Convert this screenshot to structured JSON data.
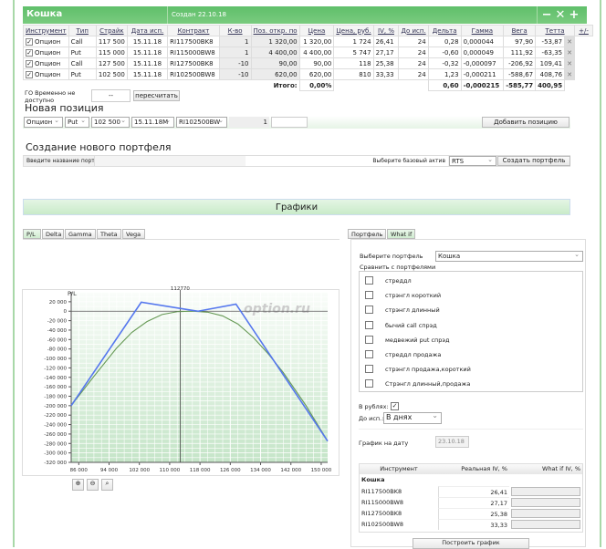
{
  "portfolio": {
    "name": "Кошка",
    "created": "Создан 22.10.18",
    "controls": [
      "−",
      "✕",
      "+"
    ]
  },
  "table": {
    "headers": [
      "Инструмент",
      "Тип",
      "Страйк",
      "Дата исп.",
      "Контракт",
      "К-во",
      "Поз. откр. по",
      "Цена",
      "Цена, руб.",
      "IV, %",
      "До исп.",
      "Дельта",
      "Гамма",
      "Вега",
      "Тетта",
      "+/-"
    ],
    "rows": [
      {
        "checked": true,
        "instrument": "Опцион",
        "type": "Call",
        "strike": "117 500",
        "date": "15.11.18",
        "contract": "RI117500BK8",
        "qty": "1",
        "open": "1 320,00",
        "price": "1 320,00",
        "price_rub": "1 724",
        "iv": "26,41",
        "days": "24",
        "delta": "0,28",
        "gamma": "0,000044",
        "vega": "97,90",
        "theta": "-53,87"
      },
      {
        "checked": true,
        "instrument": "Опцион",
        "type": "Put",
        "strike": "115 000",
        "date": "15.11.18",
        "contract": "RI115000BW8",
        "qty": "1",
        "open": "4 400,00",
        "price": "4 400,00",
        "price_rub": "5 747",
        "iv": "27,17",
        "days": "24",
        "delta": "-0,60",
        "gamma": "0,000049",
        "vega": "111,92",
        "theta": "-63,35"
      },
      {
        "checked": true,
        "instrument": "Опцион",
        "type": "Call",
        "strike": "127 500",
        "date": "15.11.18",
        "contract": "RI127500BK8",
        "qty": "-10",
        "open": "90,00",
        "price": "90,00",
        "price_rub": "118",
        "iv": "25,38",
        "days": "24",
        "delta": "-0,32",
        "gamma": "-0,000097",
        "vega": "-206,92",
        "theta": "109,41"
      },
      {
        "checked": true,
        "instrument": "Опцион",
        "type": "Put",
        "strike": "102 500",
        "date": "15.11.18",
        "contract": "RI102500BW8",
        "qty": "-10",
        "open": "620,00",
        "price": "620,00",
        "price_rub": "810",
        "iv": "33,33",
        "days": "24",
        "delta": "1,23",
        "gamma": "-0,000211",
        "vega": "-588,67",
        "theta": "408,76"
      }
    ],
    "totals": {
      "label": "Итого:",
      "price": "0,00%",
      "delta": "0,60",
      "gamma": "-0,000215",
      "vega": "-585,77",
      "theta": "400,95"
    }
  },
  "go": {
    "label": "ГО Временно не доступно",
    "value": "--",
    "recalc": "пересчитать"
  },
  "new_position": {
    "title": "Новая позиция",
    "instrument": "Опцион",
    "type": "Put",
    "strike": "102 500",
    "date": "15.11.18M",
    "contract": "RI102500BW",
    "qty": "1",
    "add": "Добавить позицию"
  },
  "new_portfolio": {
    "title": "Создание нового портфеля",
    "name_label": "Введите название портфеля",
    "asset_label": "Выберите базовый актив",
    "asset": "RTS",
    "create": "Создать портфель"
  },
  "charts": {
    "title": "Графики",
    "tabs": [
      "P/L",
      "Delta",
      "Gamma",
      "Theta",
      "Vega"
    ],
    "right_tabs": [
      "Портфель",
      "What if"
    ],
    "watermark": "option.ru"
  },
  "right": {
    "select_label": "Выберите портфель",
    "select_value": "Кошка",
    "compare_label": "Сравнить с портфелями",
    "compare": [
      "стреддл",
      "стрэнгл короткий",
      "стрэнгл длинный",
      "бычий call спрэд",
      "медвежий put спрэд",
      "стреддл продажа",
      "стрэнгл продажа,короткий",
      "Стрэнгл длинный,продажа"
    ],
    "rub_label": "В рублях:",
    "rub_checked": true,
    "exp_label": "До исп.:",
    "exp_value": "В днях",
    "date_label": "График на дату",
    "date_value": "23.10.18",
    "iv_headers": [
      "Инструмент",
      "Реальная IV, %",
      "What if IV, %"
    ],
    "iv_group": "Кошка",
    "iv_rows": [
      {
        "c": "RI117500BK8",
        "iv": "26,41"
      },
      {
        "c": "RI115000BW8",
        "iv": "27,17"
      },
      {
        "c": "RI127500BK8",
        "iv": "25,38"
      },
      {
        "c": "RI102500BW8",
        "iv": "33,33"
      }
    ],
    "build": "Построить график"
  },
  "chart_data": {
    "type": "line",
    "ylabel": "P/L",
    "xlim": [
      84000,
      151700
    ],
    "ylim": [
      -320000,
      41000
    ],
    "xticks": [
      86000,
      94000,
      102000,
      110000,
      118000,
      126000,
      134000,
      142000,
      150000
    ],
    "yticks": [
      20000,
      0,
      -20000,
      -40000,
      -60000,
      -80000,
      -100000,
      -120000,
      -140000,
      -160000,
      -180000,
      -200000,
      -220000,
      -240000,
      -260000,
      -280000,
      -300000,
      -320000
    ],
    "marker": {
      "x": 112770,
      "label": "112770"
    },
    "series": [
      {
        "name": "expiration",
        "color": "#5577ee",
        "points": [
          [
            84000,
            -200000
          ],
          [
            102500,
            19000
          ],
          [
            115000,
            3000
          ],
          [
            117500,
            0
          ],
          [
            127500,
            15000
          ],
          [
            151700,
            -275000
          ]
        ]
      },
      {
        "name": "today",
        "color": "#669955",
        "points": [
          [
            84000,
            -200000
          ],
          [
            90000,
            -138000
          ],
          [
            96000,
            -78000
          ],
          [
            100000,
            -45000
          ],
          [
            104000,
            -22000
          ],
          [
            108000,
            -7000
          ],
          [
            112000,
            -1000
          ],
          [
            116000,
            0
          ],
          [
            120000,
            -2000
          ],
          [
            124000,
            -10000
          ],
          [
            128000,
            -27000
          ],
          [
            132000,
            -55000
          ],
          [
            136000,
            -90000
          ],
          [
            140000,
            -130000
          ],
          [
            146000,
            -200000
          ],
          [
            151700,
            -275000
          ]
        ]
      }
    ]
  }
}
